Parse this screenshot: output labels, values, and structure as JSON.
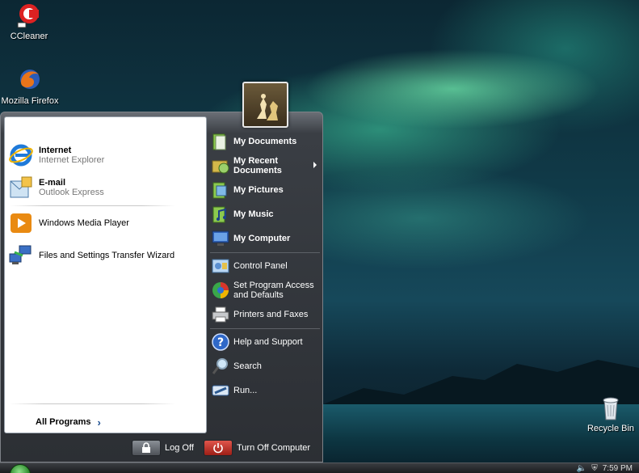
{
  "desktop": {
    "icons": [
      {
        "label": "CCleaner",
        "icon": "ccleaner-icon"
      },
      {
        "label": "Mozilla Firefox",
        "icon": "firefox-icon"
      },
      {
        "label": "Recycle Bin",
        "icon": "recycle-bin-icon"
      }
    ]
  },
  "start_menu": {
    "pinned": [
      {
        "title": "Internet",
        "subtitle": "Internet Explorer",
        "icon": "internet-explorer-icon"
      },
      {
        "title": "E-mail",
        "subtitle": "Outlook Express",
        "icon": "outlook-express-icon"
      }
    ],
    "recent": [
      {
        "label": "Windows Media Player",
        "icon": "media-player-icon"
      },
      {
        "label": "Files and Settings Transfer Wizard",
        "icon": "transfer-wizard-icon"
      }
    ],
    "all_programs_label": "All Programs",
    "places": [
      {
        "label": "My Documents",
        "icon": "my-documents-icon"
      },
      {
        "label": "My Recent Documents",
        "icon": "my-recent-documents-icon"
      },
      {
        "label": "My Pictures",
        "icon": "my-pictures-icon"
      },
      {
        "label": "My Music",
        "icon": "my-music-icon"
      },
      {
        "label": "My Computer",
        "icon": "my-computer-icon"
      }
    ],
    "settings": [
      {
        "label": "Control Panel",
        "icon": "control-panel-icon"
      },
      {
        "label": "Set Program Access and Defaults",
        "icon": "program-access-icon"
      },
      {
        "label": "Printers and Faxes",
        "icon": "printer-icon"
      }
    ],
    "help": [
      {
        "label": "Help and Support",
        "icon": "help-icon"
      },
      {
        "label": "Search",
        "icon": "search-icon"
      },
      {
        "label": "Run...",
        "icon": "run-icon"
      }
    ],
    "log_off_label": "Log Off",
    "turn_off_label": "Turn Off Computer"
  },
  "taskbar": {
    "clock": "7:59 PM"
  },
  "colors": {
    "start_orb": "#2b8a2b",
    "menu_dark": "#2c2f34",
    "turn_off_red": "#b3261e",
    "link_blue": "#1d4f91"
  }
}
